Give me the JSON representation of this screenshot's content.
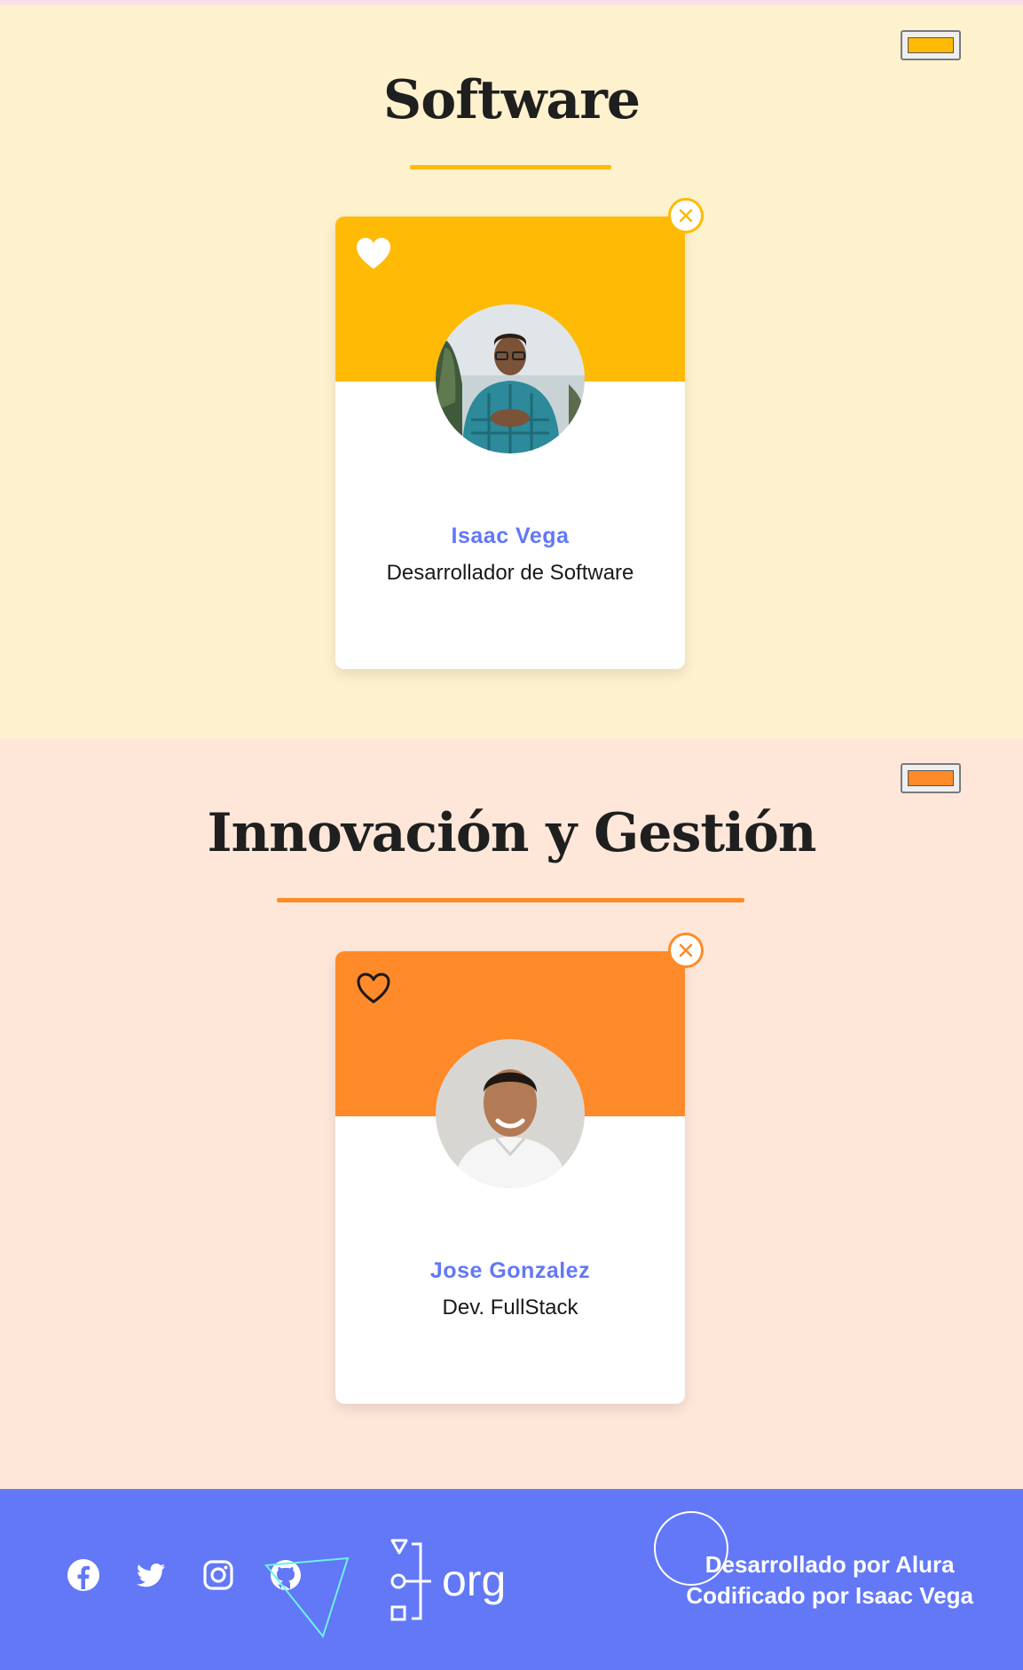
{
  "colors": {
    "software_bg": "#fef1ce",
    "software_accent": "#ffba05",
    "innovation_bg": "#fee7d9",
    "innovation_accent": "#ff8a29",
    "name_color": "#6278f7",
    "footer_bg": "#6278f7"
  },
  "sections": [
    {
      "title": "Software",
      "cards": [
        {
          "name": "Isaac Vega",
          "role": "Desarrollador de Software",
          "favorited": true,
          "photo": "person-avatar-photo"
        }
      ]
    },
    {
      "title": "Innovación y Gestión",
      "cards": [
        {
          "name": "Jose Gonzalez",
          "role": "Dev. FullStack",
          "favorited": false,
          "photo": "person-avatar-photo"
        }
      ]
    }
  ],
  "footer": {
    "social_icons": [
      "facebook-icon",
      "twitter-icon",
      "instagram-icon",
      "github-icon"
    ],
    "logo_text": "org",
    "credit_line_1": "Desarrollado por Alura",
    "credit_line_2": "Codificado por Isaac Vega"
  }
}
